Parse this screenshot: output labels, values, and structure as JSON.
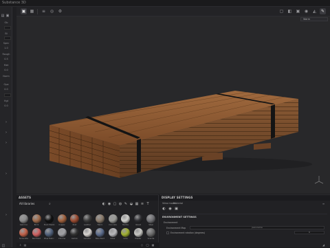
{
  "app": {
    "title": "Substance 3D"
  },
  "toolbar": {
    "buttons": [
      "select-icon",
      "grid-icon",
      "list-icon",
      "camera-icon",
      "settings-icon"
    ],
    "right_buttons": [
      "frame-icon",
      "render-icon",
      "light-icon",
      "camera-icon",
      "paint-icon",
      "layout-icon"
    ]
  },
  "viewport": {
    "environment_dropdown": "Warm",
    "background_color": "#28282a",
    "wood_color": "#8a5a34",
    "strap_color": "#151515"
  },
  "left_panel": {
    "rows": [
      "Ob",
      "Bi",
      "Spec",
      "1.0",
      "Rough",
      "0.5",
      "Met",
      "0.0",
      "Norm",
      "Opa",
      "0.0",
      "Hgt",
      "0.0"
    ]
  },
  "assets": {
    "title": "ASSETS",
    "filter_label": "All libraries",
    "search_icon": "search-icon",
    "materials": [
      {
        "name": "Cast Iron",
        "color": "#8a8a8a"
      },
      {
        "name": "Brick",
        "color": "#a06a4a"
      },
      {
        "name": "Black Plastic",
        "color": "#111111"
      },
      {
        "name": "Copper",
        "color": "#a0603c"
      },
      {
        "name": "Rust",
        "color": "#9a4a30"
      },
      {
        "name": "Leather",
        "color": "#3a3a3a"
      },
      {
        "name": "Fabric",
        "color": "#8a7a6a"
      },
      {
        "name": "Concrete",
        "color": "#9a9a96"
      },
      {
        "name": "Marble",
        "color": "#d0d0cc"
      },
      {
        "name": "Velvet",
        "color": "#2c2c30"
      },
      {
        "name": "Steel",
        "color": "#707074"
      },
      {
        "name": "Terracotta",
        "color": "#c06048"
      },
      {
        "name": "Red Paint",
        "color": "#d06060"
      },
      {
        "name": "Blue Fabric",
        "color": "#50607a"
      },
      {
        "name": "Chrome",
        "color": "#a0a0a4"
      },
      {
        "name": "Carbon",
        "color": "#303030"
      },
      {
        "name": "Ceramic",
        "color": "#d8d4d0"
      },
      {
        "name": "Blue Paint",
        "color": "#5a6a8a"
      },
      {
        "name": "Silver",
        "color": "#b8b8bc"
      },
      {
        "name": "Lime",
        "color": "#a0b030"
      },
      {
        "name": "Plaster",
        "color": "#c8c8c4"
      },
      {
        "name": "Granite",
        "color": "#6a6a6a"
      }
    ]
  },
  "display_settings": {
    "title": "DISPLAY SETTINGS",
    "tabs": [
      "View mode",
      "Material"
    ],
    "section_title": "ENVIRONMENT SETTINGS",
    "environment_label": "Environment",
    "environment_map_label": "Environment Map",
    "environment_map_value": "panorama",
    "rotation_label": "Environment rotation (degrees)",
    "rotation_value": "0"
  }
}
